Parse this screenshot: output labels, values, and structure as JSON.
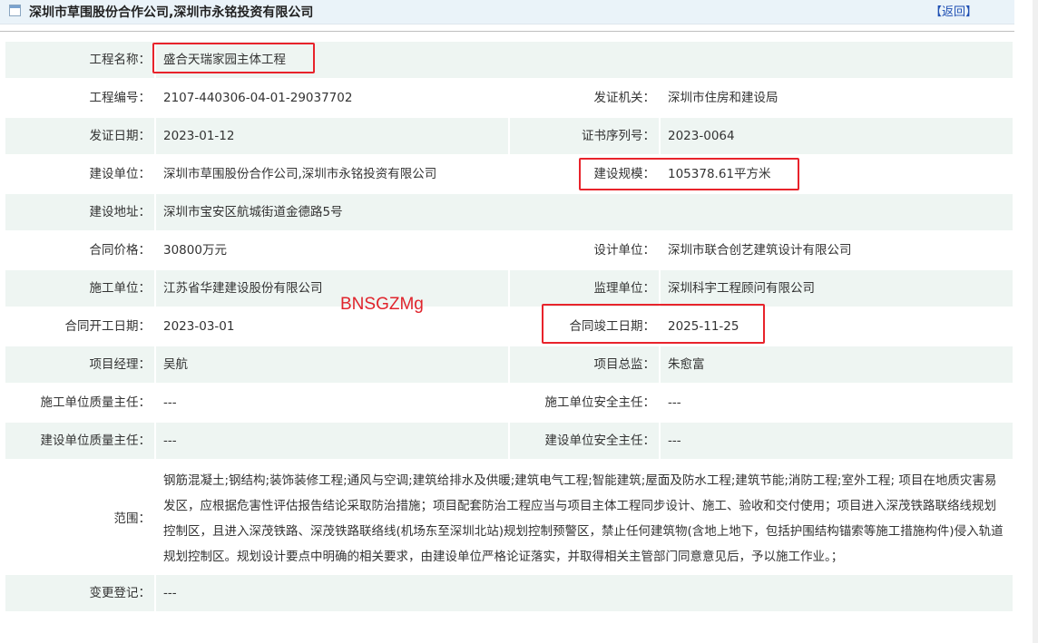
{
  "header": {
    "title": "深圳市草围股份合作公司,深圳市永铭投资有限公司",
    "back_label": "【返回】"
  },
  "watermark": "BNSGZMg",
  "fields": {
    "project_name": {
      "label": "工程名称：",
      "value": "盛合天瑞家园主体工程"
    },
    "project_code": {
      "label": "工程编号：",
      "value": "2107-440306-04-01-29037702"
    },
    "issuer": {
      "label": "发证机关：",
      "value": "深圳市住房和建设局"
    },
    "issue_date": {
      "label": "发证日期：",
      "value": "2023-01-12"
    },
    "cert_serial": {
      "label": "证书序列号：",
      "value": "2023-0064"
    },
    "builder": {
      "label": "建设单位：",
      "value": "深圳市草围股份合作公司,深圳市永铭投资有限公司"
    },
    "scale": {
      "label": "建设规模：",
      "value": "105378.61平方米"
    },
    "address": {
      "label": "建设地址：",
      "value": "深圳市宝安区航城街道金德路5号"
    },
    "contract_price": {
      "label": "合同价格：",
      "value": "30800万元"
    },
    "design_unit": {
      "label": "设计单位：",
      "value": "深圳市联合创艺建筑设计有限公司"
    },
    "construction_unit": {
      "label": "施工单位：",
      "value": "江苏省华建建设股份有限公司"
    },
    "supervision_unit": {
      "label": "监理单位：",
      "value": "深圳科宇工程顾问有限公司"
    },
    "start_date": {
      "label": "合同开工日期：",
      "value": "2023-03-01"
    },
    "end_date": {
      "label": "合同竣工日期：",
      "value": "2025-11-25"
    },
    "project_manager": {
      "label": "项目经理：",
      "value": "吴航"
    },
    "chief_supervisor": {
      "label": "项目总监：",
      "value": "朱愈富"
    },
    "constr_quality": {
      "label": "施工单位质量主任：",
      "value": "---"
    },
    "constr_safety": {
      "label": "施工单位安全主任：",
      "value": "---"
    },
    "builder_quality": {
      "label": "建设单位质量主任：",
      "value": "---"
    },
    "builder_safety": {
      "label": "建设单位安全主任：",
      "value": "---"
    },
    "scope": {
      "label": "范围：",
      "value": "钢筋混凝土;钢结构;装饰装修工程;通风与空调;建筑给排水及供暖;建筑电气工程;智能建筑;屋面及防水工程;建筑节能;消防工程;室外工程; 项目在地质灾害易发区，应根据危害性评估报告结论采取防治措施；项目配套防治工程应当与项目主体工程同步设计、施工、验收和交付使用；项目进入深茂铁路联络线规划控制区，且进入深茂铁路、深茂铁路联络线(机场东至深圳北站)规划控制预警区，禁止任何建筑物(含地上地下，包括护围结构锚索等施工措施构件)侵入轨道规划控制区。规划设计要点中明确的相关要求，由建设单位严格论证落实，并取得相关主管部门同意意见后，予以施工作业。；"
    },
    "change_record": {
      "label": "变更登记：",
      "value": "---"
    }
  }
}
